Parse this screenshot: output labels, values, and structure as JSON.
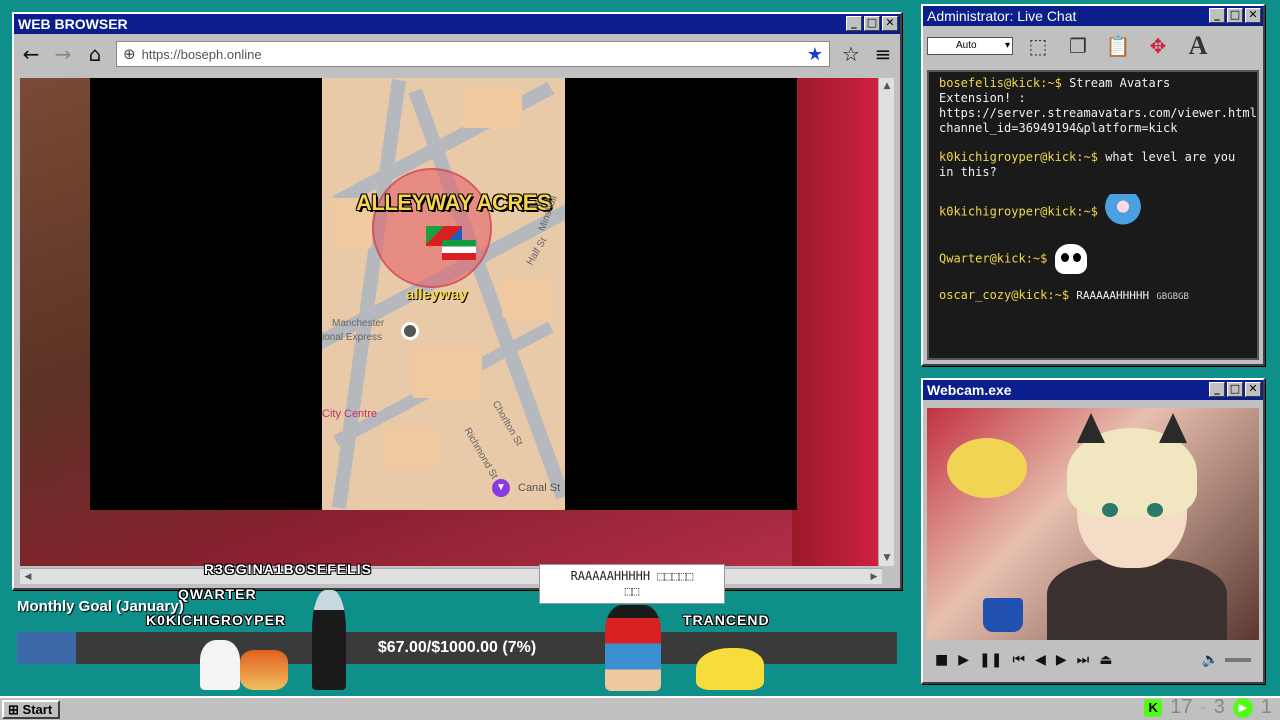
{
  "browser": {
    "title": "WEB BROWSER",
    "url": "https://boseph.online",
    "map": {
      "title": "ALLEYWAY ACRES",
      "subtitle": "alleyway",
      "labels": [
        "Manchester",
        "ional Express",
        "City Centre",
        "Canal St",
        "Richmond St",
        "Chorlton St",
        "Minshull",
        "Half St"
      ]
    }
  },
  "chat": {
    "title": "Administrator: Live Chat",
    "dropdown": "Auto",
    "messages": [
      {
        "user": "bosefelis@kick:~$",
        "text": "Stream Avatars Extension! : https://server.streamavatars.com/viewer.html?channel_id=36949194&platform=kick"
      },
      {
        "user": "k0kichigroyper@kick:~$",
        "text": "what level are you in this?"
      },
      {
        "user": "k0kichigroyper@kick:~$",
        "text": ""
      },
      {
        "user": "Qwarter@kick:~$",
        "text": ""
      },
      {
        "user": "oscar_cozy@kick:~$",
        "text": "RAAAAAHHHHH",
        "extra": "GBGBGB"
      }
    ]
  },
  "webcam": {
    "title": "Webcam.exe"
  },
  "goal": {
    "title": "Monthly Goal (January)",
    "text": "$67.00/$1000.00 (7%)",
    "progress": 0.067
  },
  "overlay": {
    "names": [
      "R3GGINA1BOSEFELIS",
      "QWARTER",
      "K0KICHIGROYPER",
      "TRANCEND"
    ],
    "bubble_line1": "RAAAAAHHHHH ⬚⬚⬚⬚⬚",
    "bubble_line2": "⬚⬚"
  },
  "taskbar": {
    "start": "Start",
    "tray_count1": "17",
    "tray_count2": "3",
    "tray_count3": "1"
  }
}
